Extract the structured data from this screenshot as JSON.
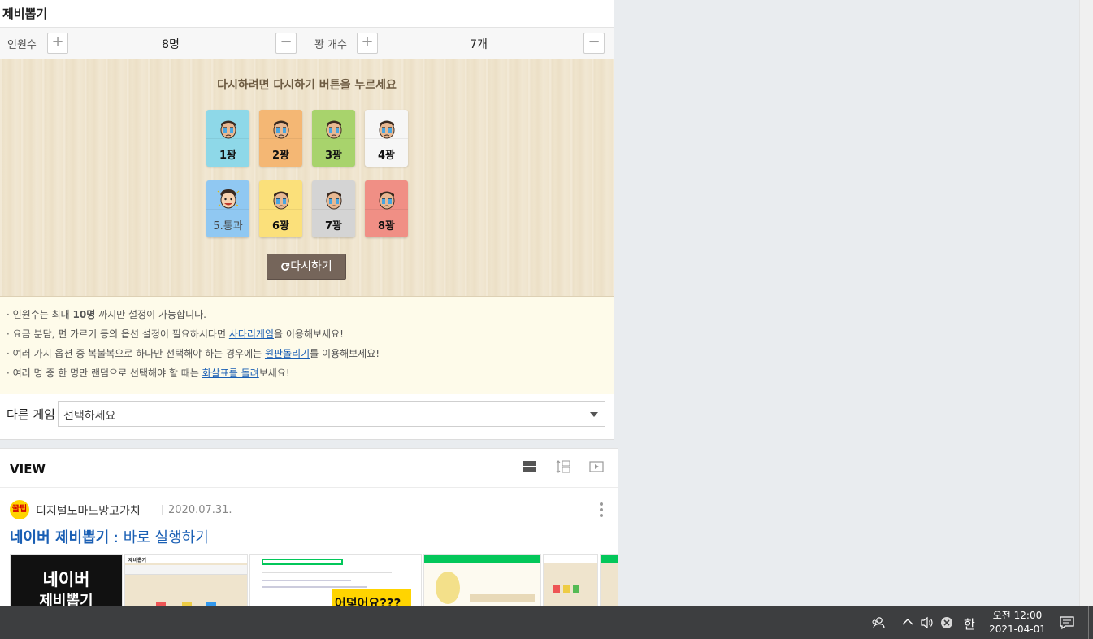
{
  "widget": {
    "title": "제비뽑기",
    "people": {
      "label": "인원수",
      "value": "8명"
    },
    "blanks": {
      "label": "꽝 개수",
      "value": "7개"
    },
    "plus": "+",
    "minus": "−",
    "message": "다시하려면 다시하기 버튼을 누르세요",
    "cards": [
      {
        "label": "1꽝",
        "color": "#8ed8e8",
        "result": "lose"
      },
      {
        "label": "2꽝",
        "color": "#f4b774",
        "result": "lose"
      },
      {
        "label": "3꽝",
        "color": "#a8d36c",
        "result": "lose"
      },
      {
        "label": "4꽝",
        "color": "#f6f6f6",
        "result": "lose"
      },
      {
        "label": "5.통과",
        "color": "#90c8f2",
        "result": "win"
      },
      {
        "label": "6꽝",
        "color": "#fbe07a",
        "result": "lose"
      },
      {
        "label": "7꽝",
        "color": "#d4d4d4",
        "result": "lose"
      },
      {
        "label": "8꽝",
        "color": "#f08f85",
        "result": "lose"
      }
    ],
    "retry_label": "다시하기",
    "notes": [
      {
        "pre": "· 인원수는 최대 ",
        "bold": "10명",
        "post": " 까지만 설정이 가능합니다."
      },
      {
        "pre": "· 요금 분담, 편 가르기 등의 옵션 설정이 필요하시다면 ",
        "link": "사다리게임",
        "post": "을 이용해보세요!"
      },
      {
        "pre": "· 여러 가지 옵션 중 복불복으로 하나만 선택해야 하는 경우에는 ",
        "link": "원판돌리기",
        "post": "를 이용해보세요!"
      },
      {
        "pre": "· 여러 명 중 한 명만 랜덤으로 선택해야 할 때는 ",
        "link": "화살표를 돌려",
        "post": "보세요!"
      }
    ],
    "other_game": {
      "label": "다른 게임",
      "selected": "선택하세요"
    }
  },
  "view": {
    "title": "VIEW",
    "icons": [
      "list-view-icon",
      "detail-view-icon",
      "video-view-icon"
    ],
    "post": {
      "badge": "꿀팁",
      "author": "디지털노마드망고가치",
      "date": "2020.07.31.",
      "title_bold": "네이버 제비뽑기",
      "title_rest": " : 바로 실행하기",
      "thumbs": [
        {
          "lines": [
            "네이버",
            "제비뽑기"
          ]
        },
        {
          "title": "제비뽑기"
        },
        {
          "caption": "어덯어요???"
        },
        {},
        {},
        {}
      ]
    }
  },
  "taskbar": {
    "ime": "한",
    "time": "오전 12:00",
    "date": "2021-04-01",
    "icons": [
      "people-icon",
      "chevron-up-icon",
      "volume-icon",
      "network-error-icon",
      "notification-icon"
    ]
  }
}
